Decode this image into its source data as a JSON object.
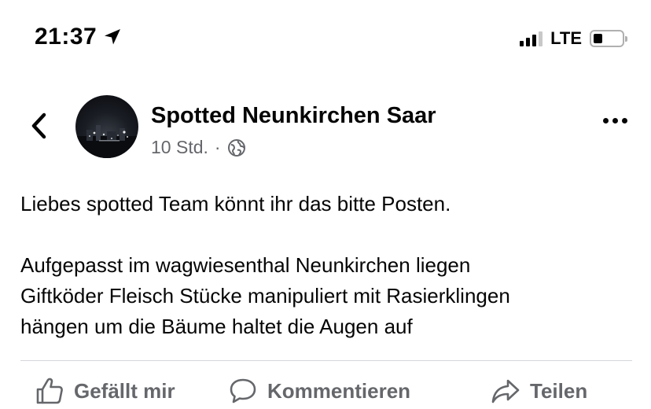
{
  "status_bar": {
    "time": "21:37",
    "network": "LTE"
  },
  "post_header": {
    "page_name": "Spotted Neunkirchen Saar",
    "time_ago": "10 Std.",
    "separator": "·"
  },
  "post": {
    "paragraph1": "Liebes spotted Team könnt ihr das bitte Posten.",
    "paragraph2_lines": [
      "Aufgepasst im wagwiesenthal Neunkirchen liegen",
      "Giftköder Fleisch Stücke manipuliert mit Rasierklingen",
      "hängen um die Bäume haltet die Augen auf"
    ]
  },
  "actions": {
    "like_label": "Gefällt mir",
    "comment_label": "Kommentieren",
    "share_label": "Teilen"
  },
  "colors": {
    "text": "#050505",
    "secondary": "#65676b",
    "divider": "#d4d6da"
  }
}
